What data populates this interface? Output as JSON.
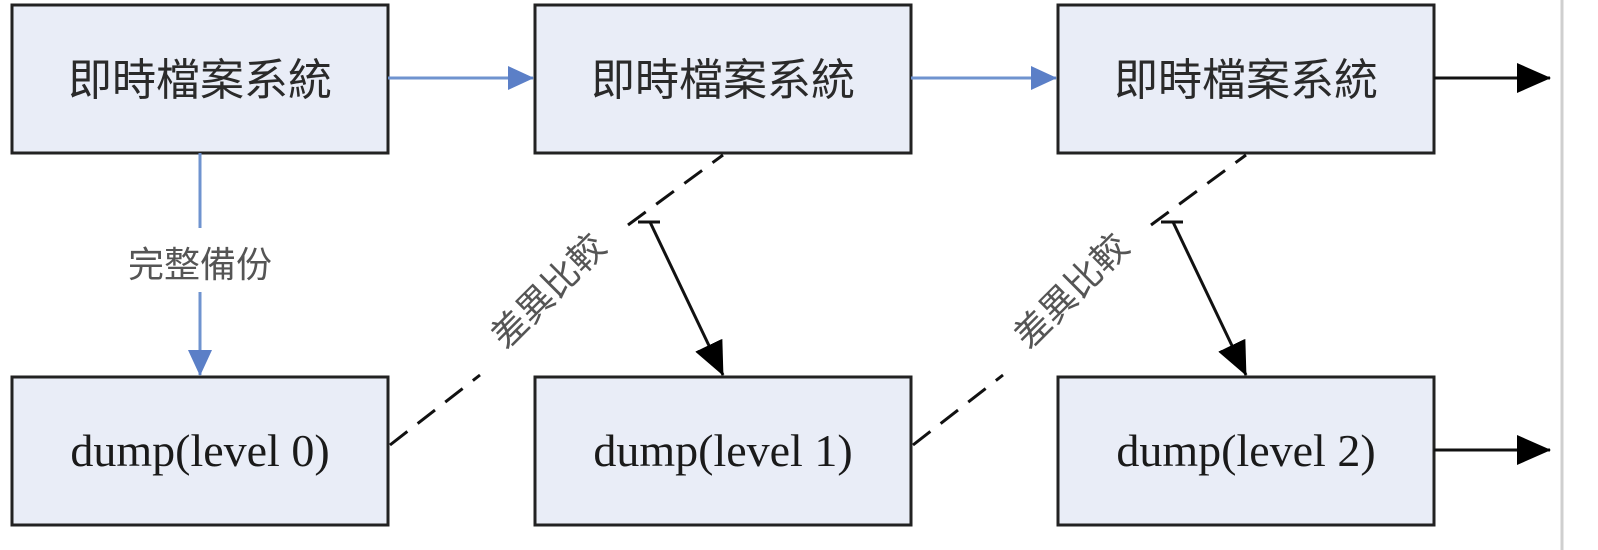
{
  "diagram": {
    "live_fs_label": "即時檔案系統",
    "full_backup_label": "完整備份",
    "diff_compare_label": "差異比較",
    "dumps": [
      "dump(level 0)",
      "dump(level 1)",
      "dump(level 2)"
    ]
  },
  "colors": {
    "box_fill": "#e9edf7",
    "box_border": "#222222",
    "blue_arrow": "#6f93cf",
    "black_arrow": "#111111"
  }
}
